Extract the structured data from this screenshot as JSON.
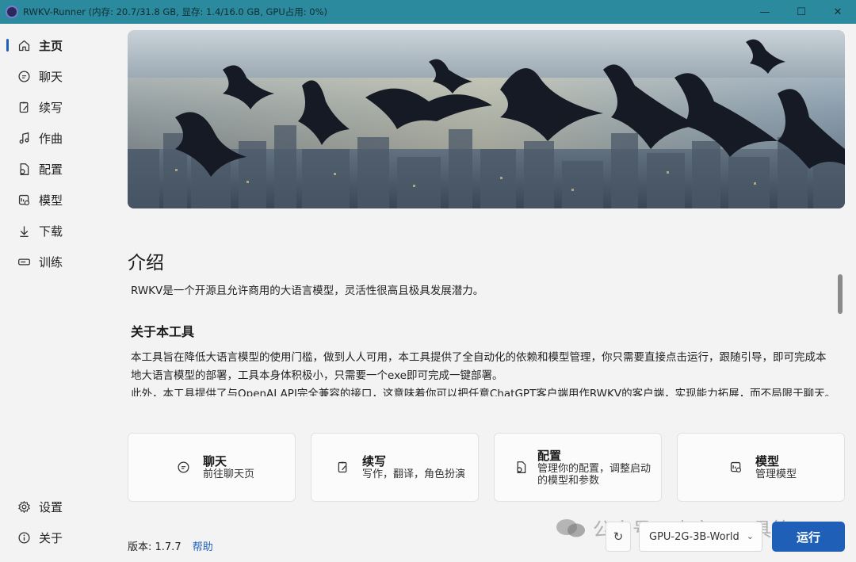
{
  "window": {
    "title": "RWKV-Runner (内存: 20.7/31.8 GB, 显存: 1.4/16.0 GB, GPU占用: 0%)",
    "controls": {
      "minimize": "—",
      "maximize": "☐",
      "close": "✕"
    }
  },
  "sidebar": {
    "items": [
      {
        "label": "主页",
        "icon": "home-icon",
        "active": true
      },
      {
        "label": "聊天",
        "icon": "chat-icon"
      },
      {
        "label": "续写",
        "icon": "write-icon"
      },
      {
        "label": "作曲",
        "icon": "music-icon"
      },
      {
        "label": "配置",
        "icon": "config-icon"
      },
      {
        "label": "模型",
        "icon": "model-icon"
      },
      {
        "label": "下载",
        "icon": "download-icon"
      },
      {
        "label": "训练",
        "icon": "train-icon"
      }
    ],
    "bottom": [
      {
        "label": "设置",
        "icon": "gear-icon"
      },
      {
        "label": "关于",
        "icon": "info-icon"
      }
    ]
  },
  "main": {
    "intro_heading": "介绍",
    "intro_text": "RWKV是一个开源且允许商用的大语言模型，灵活性很高且极具发展潜力。",
    "about_heading": "关于本工具",
    "about_text_1": "本工具旨在降低大语言模型的使用门槛，做到人人可用，本工具提供了全自动化的依赖和模型管理，你只需要直接点击运行，跟随引导，即可完成本地大语言模型的部署，工具本身体积极小，只需要一个exe即可完成一键部署。",
    "about_text_2": "此外，本工具提供了与OpenAI API完全兼容的接口，这意味着你可以把任意ChatGPT客户端用作RWKV的客户端，实现能力拓展，而不局限于聊天。"
  },
  "cards": [
    {
      "title": "聊天",
      "desc": "前往聊天页",
      "icon": "chat-icon"
    },
    {
      "title": "续写",
      "desc": "写作，翻译，角色扮演",
      "icon": "write-icon"
    },
    {
      "title": "配置",
      "desc": "管理你的配置，调整启动的模型和参数",
      "icon": "config-icon"
    },
    {
      "title": "模型",
      "desc": "管理模型",
      "icon": "model-icon"
    }
  ],
  "footer": {
    "version": "版本: 1.7.7",
    "help": "帮助",
    "model_selected": "GPU-2G-3B-World",
    "run": "运行"
  },
  "watermark": "公众号 · 小言AI工具箱",
  "colors": {
    "titlebar": "#2b8a9e",
    "accent": "#1f5fb8"
  }
}
